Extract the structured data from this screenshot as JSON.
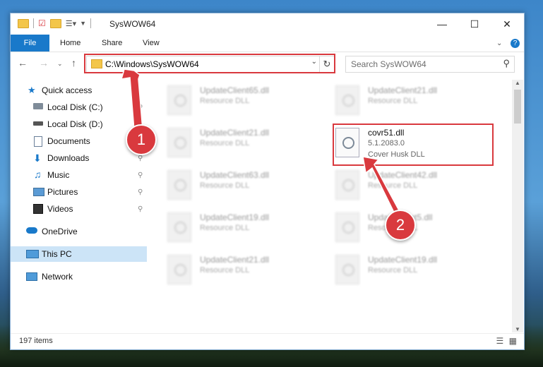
{
  "window": {
    "title": "SysWOW64"
  },
  "ribbon": {
    "tabs": [
      "File",
      "Home",
      "Share",
      "View"
    ]
  },
  "address": {
    "path": "C:\\Windows\\SysWOW64"
  },
  "search": {
    "placeholder": "Search SysWOW64"
  },
  "nav": {
    "items": [
      {
        "label": "Quick access",
        "icon": "star-icon",
        "pinned": false
      },
      {
        "label": "Local Disk (C:)",
        "icon": "disk-icon",
        "pinned": true
      },
      {
        "label": "Local Disk (D:)",
        "icon": "disk-icon",
        "pinned": true
      },
      {
        "label": "Documents",
        "icon": "document-icon",
        "pinned": true
      },
      {
        "label": "Downloads",
        "icon": "download-icon",
        "pinned": true
      },
      {
        "label": "Music",
        "icon": "music-icon",
        "pinned": true
      },
      {
        "label": "Pictures",
        "icon": "picture-icon",
        "pinned": true
      },
      {
        "label": "Videos",
        "icon": "video-icon",
        "pinned": true
      },
      {
        "label": "OneDrive",
        "icon": "cloud-icon",
        "pinned": false
      },
      {
        "label": "This PC",
        "icon": "computer-icon",
        "pinned": false
      },
      {
        "label": "Network",
        "icon": "network-icon",
        "pinned": false
      }
    ]
  },
  "files": [
    {
      "name": "UpdateClient65.dll",
      "desc": "Resource DLL"
    },
    {
      "name": "UpdateClient21.dll",
      "desc": "Resource DLL"
    },
    {
      "name": "UpdateClient21.dll",
      "desc": "Resource DLL"
    },
    {
      "name": "covr51.dll",
      "desc": "5.1.2083.0",
      "desc2": "Cover Husk DLL"
    },
    {
      "name": "UpdateClient63.dll",
      "desc": "Resource DLL"
    },
    {
      "name": "UpdateClient42.dll",
      "desc": "Resource DLL"
    },
    {
      "name": "UpdateClient19.dll",
      "desc": "Resource DLL"
    },
    {
      "name": "UpdateClient5.dll",
      "desc": "Resource DLL"
    },
    {
      "name": "UpdateClient21.dll",
      "desc": "Resource DLL"
    },
    {
      "name": "UpdateClient19.dll",
      "desc": "Resource DLL"
    }
  ],
  "status": {
    "item_count": "197 items"
  },
  "callouts": [
    "1",
    "2"
  ],
  "colors": {
    "accent": "#1979ca",
    "highlight": "#d9393e",
    "selection": "#cce4f7"
  }
}
